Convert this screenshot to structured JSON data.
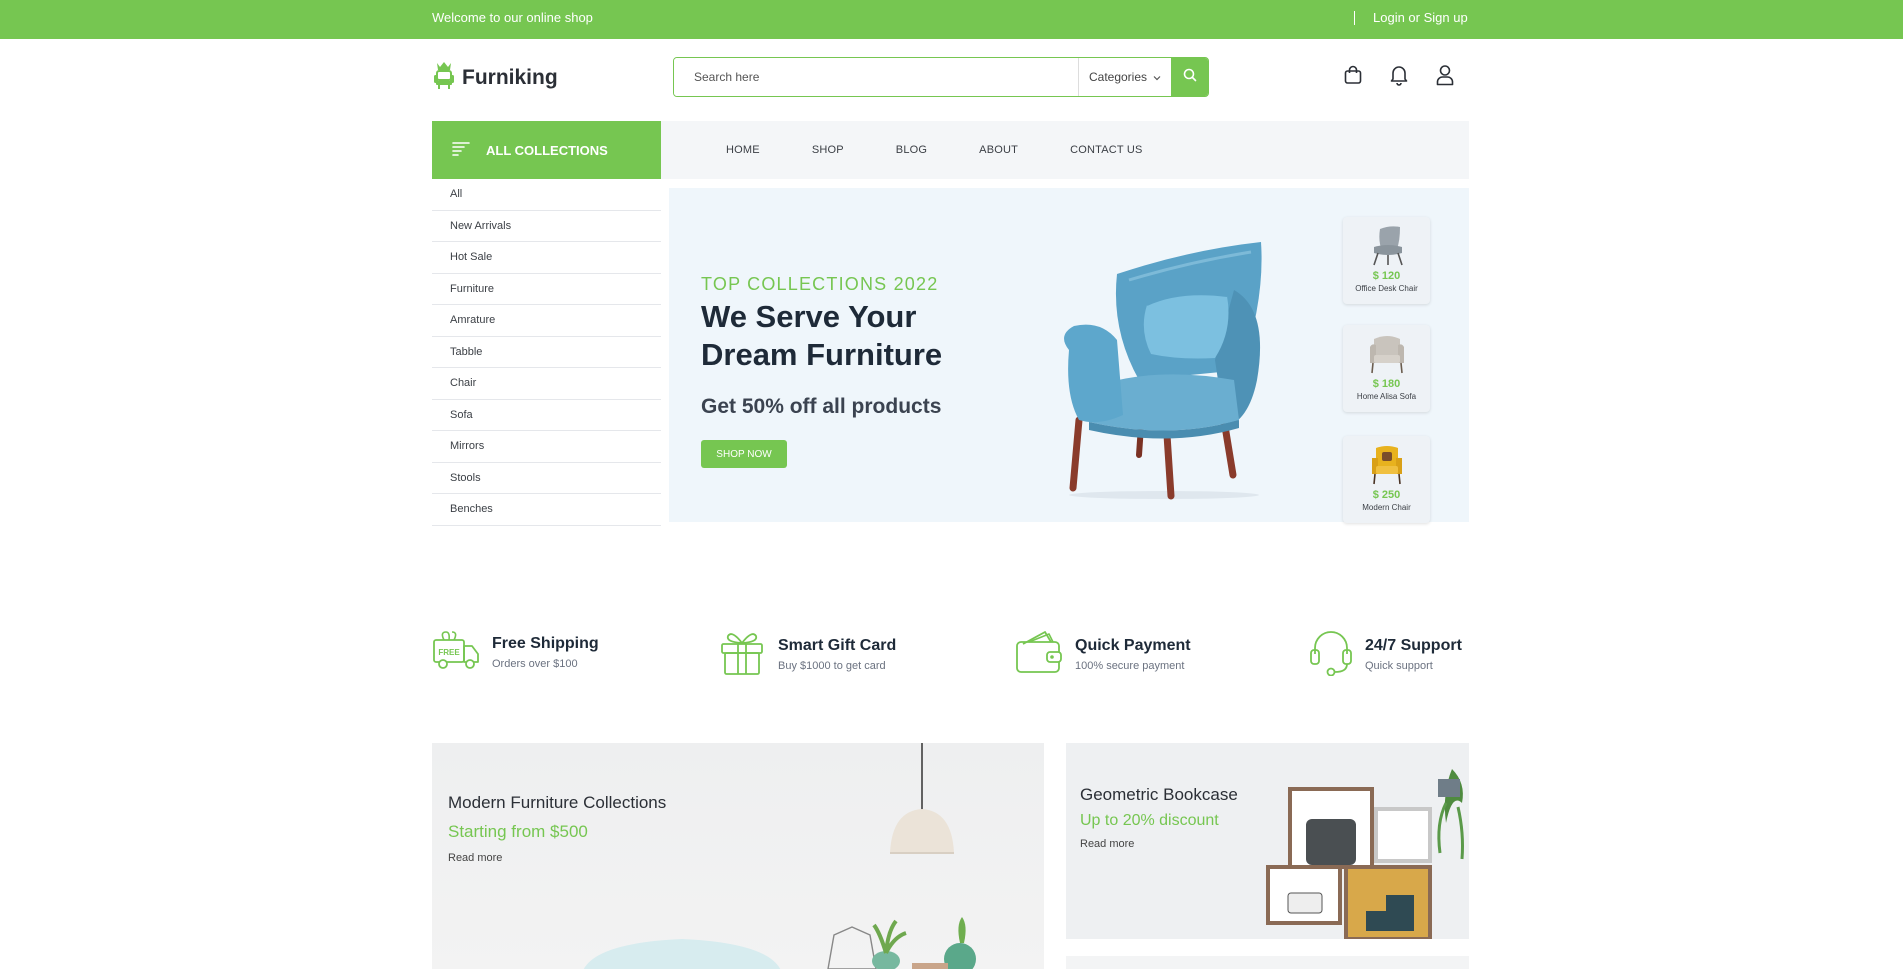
{
  "topbar": {
    "welcome": "Welcome to our online shop",
    "login": "Login or Sign up",
    "bg_color": "#76c651"
  },
  "header": {
    "logo_text": "Furniking",
    "search_placeholder": "Search here",
    "category_label": "Categories",
    "icons": [
      "bag-icon",
      "bell-icon",
      "user-icon"
    ]
  },
  "sidebar": {
    "heading": "ALL COLLECTIONS",
    "items": [
      "All",
      "New Arrivals",
      "Hot Sale",
      "Furniture",
      "Amrature",
      "Tabble",
      "Chair",
      "Sofa",
      "Mirrors",
      "Stools",
      "Benches"
    ]
  },
  "nav": {
    "items": [
      "HOME",
      "SHOP",
      "BLOG",
      "ABOUT",
      "CONTACT US"
    ]
  },
  "hero": {
    "kicker": "TOP COLLECTIONS 2022",
    "headline": "We Serve Your Dream Furniture",
    "offer": "Get 50% off all products",
    "cta": "SHOP NOW",
    "mini_products": [
      {
        "price": "$ 120",
        "name": "Office Desk Chair"
      },
      {
        "price": "$ 180",
        "name": "Home Alisa Sofa"
      },
      {
        "price": "$ 250",
        "name": "Modern Chair"
      }
    ]
  },
  "features": [
    {
      "title": "Free Shipping",
      "subtitle": "Orders over $100",
      "icon": "truck-icon"
    },
    {
      "title": "Smart Gift Card",
      "subtitle": "Buy $1000 to get card",
      "icon": "gift-icon"
    },
    {
      "title": "Quick Payment",
      "subtitle": "100% secure payment",
      "icon": "wallet-icon"
    },
    {
      "title": "24/7 Support",
      "subtitle": "Quick support",
      "icon": "headset-icon"
    }
  ],
  "banners": [
    {
      "title": "Modern Furniture Collections",
      "subtitle": "Starting from $500",
      "link": "Read more"
    },
    {
      "title": "Geometric Bookcase",
      "subtitle": "Up to 20% discount",
      "link": "Read more"
    }
  ],
  "colors": {
    "accent": "#76c651",
    "dark": "#1e2a38",
    "hero_bg": "#eff6fb"
  }
}
